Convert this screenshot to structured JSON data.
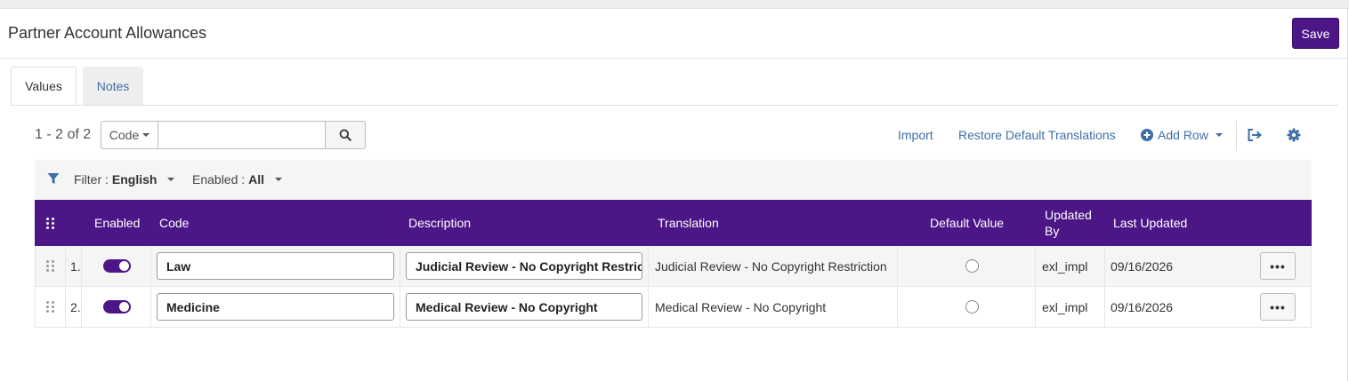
{
  "header": {
    "title": "Partner Account Allowances",
    "save_label": "Save"
  },
  "tabs": [
    {
      "label": "Values",
      "active": true
    },
    {
      "label": "Notes",
      "active": false
    }
  ],
  "toolbar": {
    "count": "1 - 2 of 2",
    "search_field": "Code",
    "search_value": "",
    "import_label": "Import",
    "restore_label": "Restore Default Translations",
    "add_row_label": "Add Row"
  },
  "filters": {
    "filter_label": "Filter :",
    "filter_value": "English",
    "enabled_label": "Enabled :",
    "enabled_value": "All"
  },
  "table": {
    "headers": {
      "enabled": "Enabled",
      "code": "Code",
      "description": "Description",
      "translation": "Translation",
      "default_value": "Default Value",
      "updated_by_1": "Updated",
      "updated_by_2": "By",
      "last_updated": "Last Updated"
    },
    "rows": [
      {
        "num": "1.",
        "enabled": true,
        "code": "Law",
        "description": "Judicial Review - No Copyright Restriction",
        "translation": "Judicial Review - No Copyright Restriction",
        "default": false,
        "updated_by": "exl_impl",
        "last_updated": "09/16/2026",
        "actions": "•••"
      },
      {
        "num": "2.",
        "enabled": true,
        "code": "Medicine",
        "description": "Medical Review - No Copyright",
        "translation": "Medical Review - No Copyright",
        "default": false,
        "updated_by": "exl_impl",
        "last_updated": "09/16/2026",
        "actions": "•••"
      }
    ]
  },
  "colors": {
    "accent": "#4c1687",
    "link": "#3e6ea6"
  }
}
